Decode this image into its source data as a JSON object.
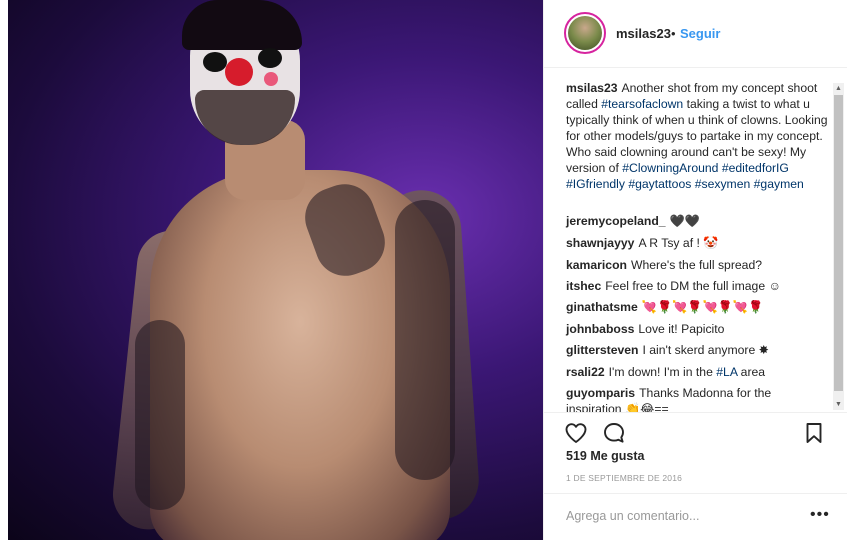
{
  "post": {
    "username": "msilas23",
    "separator": "•",
    "follow_label": "Seguir",
    "caption_prefix": "Another shot from my concept shoot called ",
    "caption_tag1": "#tearsofaclown",
    "caption_mid": " taking a twist to what u typically think of when u think of clowns. Looking for other models/guys to partake in my concept. Who said clowning around can't be sexy! My version of ",
    "caption_tags2": "#ClowningAround #editedforIG #IGfriendly #gaytattoos #sexymen #gaymen",
    "likes": "519 Me gusta",
    "date": "1 DE SEPTIEMBRE DE 2016",
    "comment_placeholder": "Agrega un comentario...",
    "more_label": "•••"
  },
  "comments": [
    {
      "user": "jeremycopeland_",
      "text": "🖤🖤"
    },
    {
      "user": "shawnjayyy",
      "text": "A R Tsy af ! 🤡"
    },
    {
      "user": "kamaricon",
      "text": "Where's the full spread?"
    },
    {
      "user": "itshec",
      "text": "Feel free to DM the full image ☺"
    },
    {
      "user": "ginathatsme",
      "text": "💘🌹💘🌹💘🌹💘🌹"
    },
    {
      "user": "johnbaboss",
      "text": "Love it! Papicito"
    },
    {
      "user": "glittersteven",
      "text": "I ain't skerd anymore ✸"
    },
    {
      "user": "rsali22",
      "text_prefix": "I'm down! I'm in the ",
      "tag": "#LA",
      "text_suffix": " area"
    },
    {
      "user": "guyomparis",
      "text": "Thanks Madonna for the inspiration 👏😂=="
    }
  ],
  "icons": {
    "like": "heart-icon",
    "comment": "comment-icon",
    "save": "bookmark-icon",
    "scroll_up": "▲",
    "scroll_down": "▼"
  },
  "colors": {
    "follow": "#3897f0",
    "hashtag": "#003569",
    "avatar_ring": "#d6249f"
  }
}
